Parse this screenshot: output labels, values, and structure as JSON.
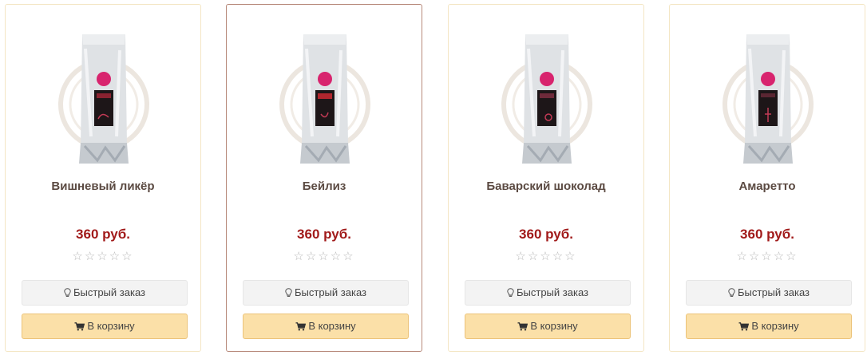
{
  "icons": {
    "quick_order": "lightbulb-icon",
    "cart": "shopping-cart-icon",
    "star": "star-outline-icon"
  },
  "colors": {
    "price": "#a11a1a",
    "cart_button": "#fbe0a8",
    "quick_button": "#f3f3f3",
    "card_border": "#f4e6c4",
    "card_border_hover": "#b7897a"
  },
  "products": [
    {
      "title": "Вишневый ликёр",
      "price": "360 руб.",
      "rating": 0,
      "stars": "☆☆☆☆☆",
      "quick_order_label": "Быстрый заказ",
      "cart_label": "В корзину"
    },
    {
      "title": "Бейлиз",
      "price": "360 руб.",
      "rating": 0,
      "stars": "☆☆☆☆☆",
      "quick_order_label": "Быстрый заказ",
      "cart_label": "В корзину"
    },
    {
      "title": "Баварский шоколад",
      "price": "360 руб.",
      "rating": 0,
      "stars": "☆☆☆☆☆",
      "quick_order_label": "Быстрый заказ",
      "cart_label": "В корзину"
    },
    {
      "title": "Амаретто",
      "price": "360 руб.",
      "rating": 0,
      "stars": "☆☆☆☆☆",
      "quick_order_label": "Быстрый заказ",
      "cart_label": "В корзину"
    }
  ]
}
